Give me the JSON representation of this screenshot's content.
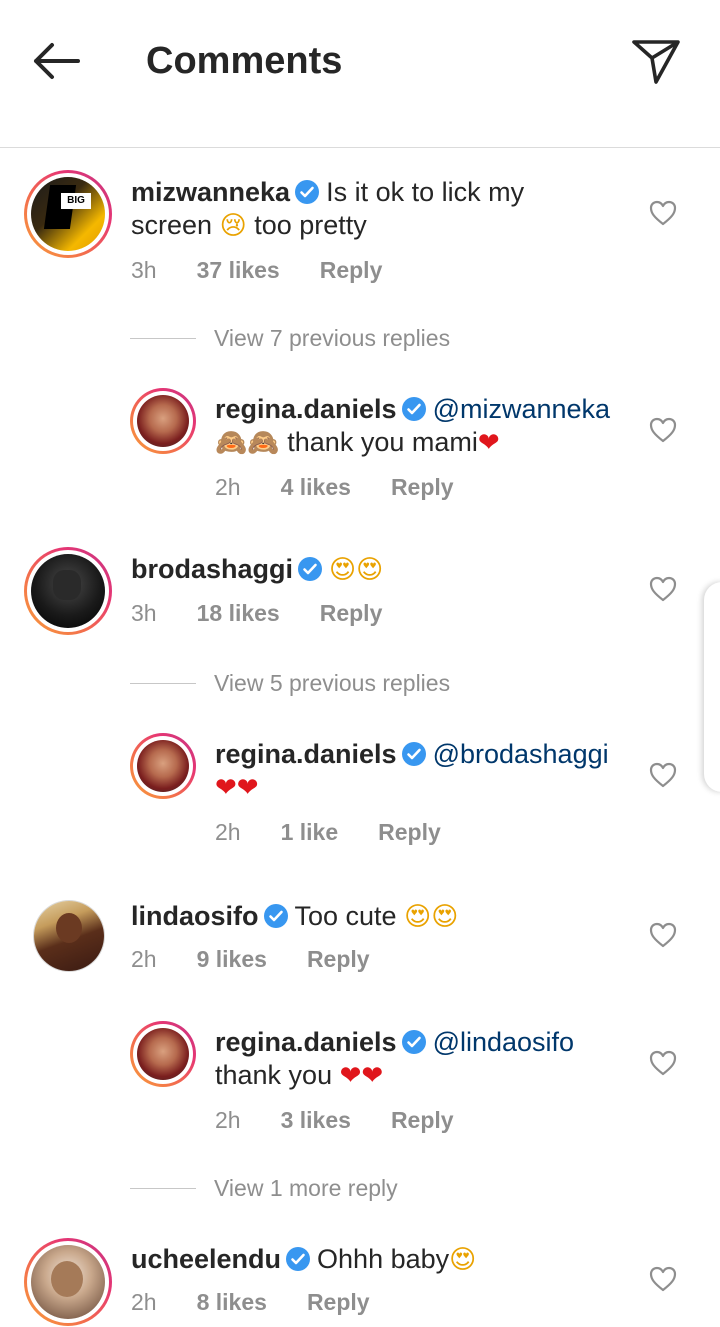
{
  "header": {
    "title": "Comments",
    "back_icon": "arrow-left-icon",
    "send_icon": "paper-plane-icon"
  },
  "comments": [
    {
      "username": "mizwanneka",
      "text_line1": "Is it ok to lick my",
      "text_line2": "screen",
      "emoji": "😢",
      "text_tail": "too pretty",
      "time": "3h",
      "likes": "37 likes",
      "reply": "Reply",
      "view_replies": "View 7 previous replies"
    },
    {
      "username": "regina.daniels",
      "mention": "@mizwanneka",
      "emoji": "🙈🙈",
      "text": "thank you mami",
      "heart": "❤",
      "time": "2h",
      "likes": "4 likes",
      "reply": "Reply"
    },
    {
      "username": "brodashaggi",
      "emoji": "😍😍",
      "time": "3h",
      "likes": "18 likes",
      "reply": "Reply",
      "view_replies": "View 5 previous replies"
    },
    {
      "username": "regina.daniels",
      "mention": "@brodashaggi",
      "hearts": "❤❤",
      "time": "2h",
      "likes": "1 like",
      "reply": "Reply"
    },
    {
      "username": "lindaosifo",
      "text": "Too cute",
      "emoji": "😍😍",
      "time": "2h",
      "likes": "9 likes",
      "reply": "Reply"
    },
    {
      "username": "regina.daniels",
      "mention": "@lindaosifo",
      "text": "thank you",
      "hearts": "❤❤",
      "time": "2h",
      "likes": "3 likes",
      "reply": "Reply",
      "view_replies": "View 1 more reply"
    },
    {
      "username": "ucheelendu",
      "text": "Ohhh baby",
      "emoji": "😍",
      "time": "2h",
      "likes": "8 likes",
      "reply": "Reply"
    }
  ],
  "colors": {
    "verified": "#3897f0",
    "mention": "#00376b",
    "meta": "#8e8e8e",
    "heart": "#e0161c"
  }
}
